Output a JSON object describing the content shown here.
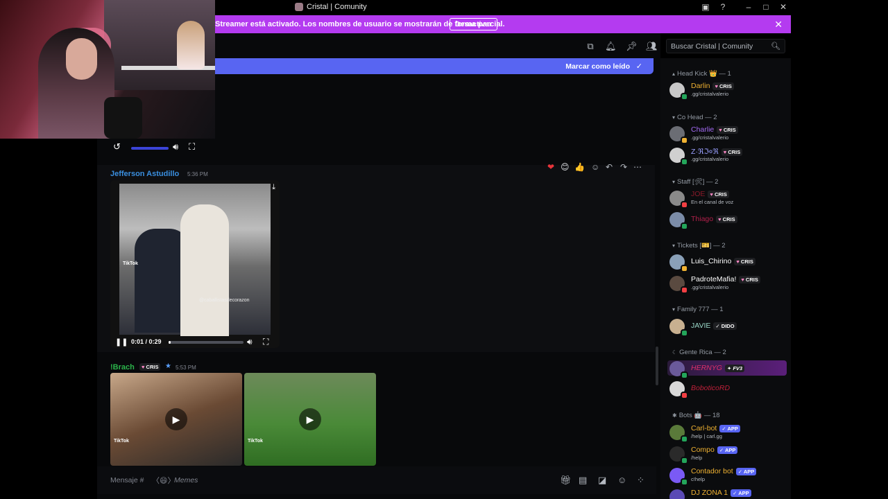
{
  "window": {
    "title": "Cristal | Comunity",
    "controls": [
      "minimize",
      "maximize",
      "close"
    ]
  },
  "banner": {
    "text": "Streamer está activado. Los nombres de usuario se mostrarán de forma parcial.",
    "button": "Desactivar"
  },
  "header": {
    "search_placeholder": "Buscar Cristal | Comunity"
  },
  "mark_read": {
    "label": "Marcar como leído"
  },
  "messages": [
    {
      "author": "Jefferson Astudillo",
      "time": "5:36 PM",
      "video": {
        "tiktok_label": "TikTok",
        "watermark": "@caballistasdecorazon",
        "time_display": "0:01 / 0:29",
        "progress": 0.03
      }
    },
    {
      "author": "!Brach",
      "tag": "CRIS",
      "time": "5:53 PM"
    }
  ],
  "composer": {
    "placeholder": "Mensaje #",
    "channel_name": "Memes"
  },
  "members": {
    "groups": [
      {
        "name": "Head Kick 👑 — 1",
        "users": [
          {
            "name": "Darlin",
            "tag": "CRIS",
            "sub": ".gg/cristalvalerio",
            "color": "#f0b232"
          }
        ]
      },
      {
        "name": "Co Head — 2",
        "users": [
          {
            "name": "Charlie",
            "tag": "CRIS",
            "sub": ".gg/cristalvalerio",
            "color": "#a56bf5"
          },
          {
            "name": "Z·ℜℑ०ℜ",
            "tag": "CRIS",
            "sub": ".gg/cristalvalerio",
            "color": "#9aa0ff"
          }
        ]
      },
      {
        "name": "Staff [🛠] — 2",
        "users": [
          {
            "name": "JOE",
            "tag": "CRIS",
            "sub": "En el canal de voz",
            "color": "#8b1a2a"
          },
          {
            "name": "Thiago",
            "tag": "CRIS",
            "sub": "",
            "color": "#b0204a"
          }
        ]
      },
      {
        "name": "Tickets [🎫] — 2",
        "users": [
          {
            "name": "Luis_Chirino",
            "tag": "CRIS",
            "sub": "",
            "color": "#ffffff"
          },
          {
            "name": "PadroteMafia!",
            "tag": "CRIS",
            "sub": ".gg/cristalvalerio",
            "color": "#ffffff"
          }
        ]
      },
      {
        "name": "Family 777 — 1",
        "users": [
          {
            "name": "JAVIE",
            "tag": "DIDO",
            "sub": "",
            "color": "#9ad8c8"
          }
        ]
      },
      {
        "name": "Gente Rica — 2",
        "users": [
          {
            "name": "HERNYG",
            "tag": "FV3",
            "sub": "",
            "color": "#e0306a"
          },
          {
            "name": "BoboticoRD",
            "tag": "",
            "sub": "",
            "color": "#c0203a"
          }
        ]
      },
      {
        "name": "Bots 🤖 — 18",
        "users": [
          {
            "name": "Carl-bot",
            "tag": "APP",
            "sub": "/help | carl.gg",
            "color": "#f0b232"
          },
          {
            "name": "Compo",
            "tag": "APP",
            "sub": "/help",
            "color": "#f0b232"
          },
          {
            "name": "Contador bot",
            "tag": "APP",
            "sub": "c!help",
            "color": "#f0b232"
          },
          {
            "name": "DJ ZONA 1",
            "tag": "APP",
            "sub": "",
            "color": "#f0b232"
          }
        ]
      }
    ]
  },
  "colors": {
    "banner": "#b43bf0",
    "accent": "#5865f2",
    "background": "#08090b"
  }
}
